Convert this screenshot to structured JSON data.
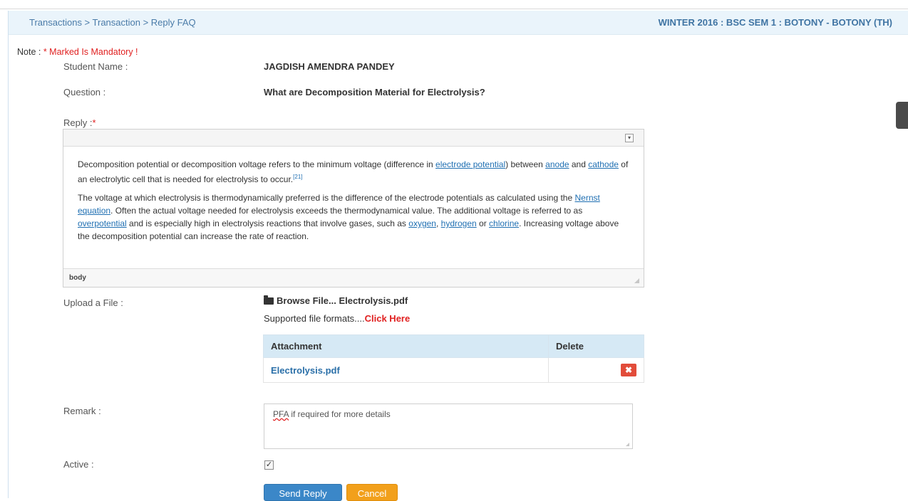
{
  "breadcrumb": {
    "items": [
      "Transactions",
      "Transaction",
      "Reply FAQ"
    ],
    "sep": " > "
  },
  "course": "WINTER 2016 : BSC SEM 1 : BOTONY - BOTONY (TH)",
  "note": {
    "label": "Note : ",
    "mandatory": "* Marked Is Mandatory !"
  },
  "student": {
    "label": "Student Name :",
    "value": "JAGDISH AMENDRA PANDEY"
  },
  "question": {
    "label": "Question :",
    "value": "What are Decomposition Material for Electrolysis?"
  },
  "reply": {
    "label": "Reply :",
    "star": "*",
    "status_path": "body",
    "p1": {
      "t1": "Decomposition potential or decomposition voltage refers to the minimum voltage (difference in ",
      "l1": "electrode potential",
      "t2": ") between ",
      "l2": "anode",
      "t3": " and ",
      "l3": "cathode",
      "t4": " of an electrolytic cell that is needed for electrolysis to occur.",
      "cite": "[21]"
    },
    "p2": {
      "t1": "The voltage at which electrolysis is thermodynamically preferred is the difference of the electrode potentials as calculated using the ",
      "l1": "Nernst equation",
      "t2": ". Often the actual voltage needed for electrolysis exceeds the thermodynamical value. The additional voltage is referred to as ",
      "l2": "overpotential",
      "t3": " and is especially high in electrolysis reactions that involve gases, such as ",
      "l3": "oxygen",
      "t4": ", ",
      "l4": "hydrogen",
      "t5": " or ",
      "l5": "chlorine",
      "t6": ". Increasing voltage above the decomposition potential can increase the rate of reaction."
    }
  },
  "upload": {
    "label": "Upload a File :",
    "browse": "Browse File...",
    "filename": "Electrolysis.pdf",
    "formats": "Supported file formats....",
    "click_here": "Click Here"
  },
  "attachments": {
    "headers": [
      "Attachment",
      "Delete"
    ],
    "rows": [
      {
        "name": "Electrolysis.pdf"
      }
    ]
  },
  "remark": {
    "label": "Remark :",
    "value_pfa": "PFA",
    "value_rest": " if required for more details"
  },
  "active": {
    "label": "Active :",
    "checked": "✓"
  },
  "buttons": {
    "send": "Send Reply",
    "cancel": "Cancel"
  },
  "icons": {
    "folder": "folder-open-icon",
    "delete": "times-icon"
  },
  "colors": {
    "primary": "#3b87c8",
    "warning": "#f2a01b",
    "danger": "#e24c3a",
    "required": "#e02020"
  }
}
